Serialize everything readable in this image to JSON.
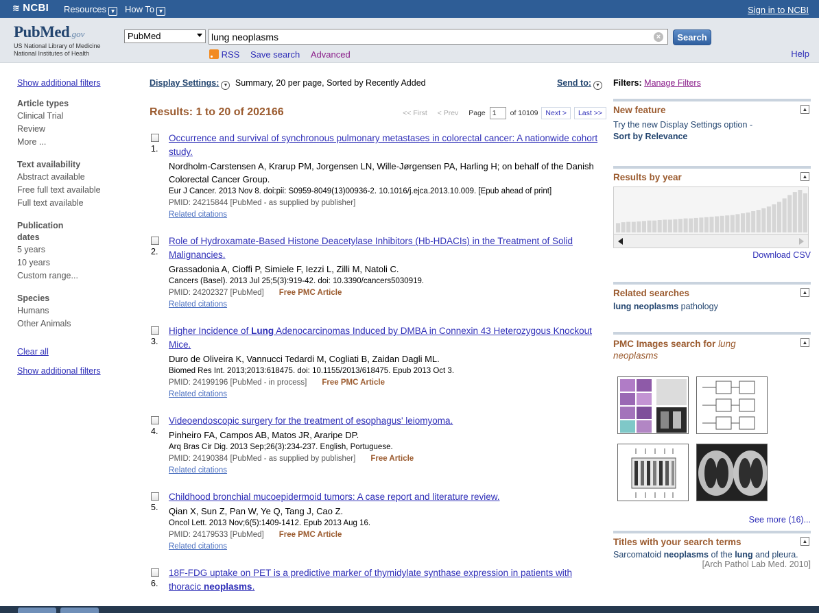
{
  "topbar": {
    "brand": "NCBI",
    "menus": [
      "Resources",
      "How To"
    ],
    "signin": "Sign in to NCBI"
  },
  "header": {
    "logo_pub": "Pub",
    "logo_med": "Med",
    "logo_gov": ".gov",
    "logo_line1": "US National Library of Medicine",
    "logo_line2": "National Institutes of Health",
    "database": "PubMed",
    "query": "lung neoplasms",
    "search_button": "Search",
    "rss": "RSS",
    "save_search": "Save search",
    "advanced": "Advanced",
    "help": "Help"
  },
  "left": {
    "show_filters_top": "Show additional filters",
    "groups": [
      {
        "title": "Article types",
        "items": [
          "Clinical Trial",
          "Review",
          "More ..."
        ]
      },
      {
        "title": "Text availability",
        "items": [
          "Abstract available",
          "Free full text available",
          "Full text available"
        ]
      },
      {
        "title": "Publication dates",
        "items": [
          "5 years",
          "10 years",
          "Custom range..."
        ]
      },
      {
        "title": "Species",
        "items": [
          "Humans",
          "Other Animals"
        ]
      }
    ],
    "clear_all": "Clear all",
    "show_filters_bottom": "Show additional filters"
  },
  "main": {
    "display_settings": "Display Settings:",
    "display_summary": "Summary, 20 per page, Sorted by Recently Added",
    "send_to": "Send to:",
    "results_label": "Results: 1 to 20 of 202166",
    "pager": {
      "first": "<< First",
      "prev": "< Prev",
      "page_label": "Page",
      "page_value": "1",
      "of_label": "of 10109",
      "next": "Next >",
      "last": "Last >>"
    },
    "results": [
      {
        "num": "1.",
        "title_parts": [
          "Occurrence and survival of synchronous pulmonary metastases in colorectal cancer: A nationwide cohort study."
        ],
        "authors": "Nordholm-Carstensen A, Krarup PM, Jorgensen LN, Wille-Jørgensen PA, Harling H; on behalf of the Danish Colorectal Cancer Group.",
        "journal": "Eur J Cancer. 2013 Nov 8. doi:pii: S0959-8049(13)00936-2. 10.1016/j.ejca.2013.10.009. [Epub ahead of print]",
        "pmid": "PMID: 24215844 [PubMed - as supplied by publisher]",
        "free": "",
        "related": "Related citations"
      },
      {
        "num": "2.",
        "title_parts": [
          "Role of Hydroxamate-Based Histone Deacetylase Inhibitors (Hb-HDACIs) in the Treatment of Solid Malignancies."
        ],
        "authors": "Grassadonia A, Cioffi P, Simiele F, Iezzi L, Zilli M, Natoli C.",
        "journal": "Cancers (Basel). 2013 Jul 25;5(3):919-42. doi: 10.3390/cancers5030919.",
        "pmid": "PMID: 24202327 [PubMed]",
        "free": "Free PMC Article",
        "related": "Related citations"
      },
      {
        "num": "3.",
        "title_parts": [
          "Higher Incidence of ",
          "Lung",
          " Adenocarcinomas Induced by DMBA in Connexin 43 Heterozygous Knockout Mice."
        ],
        "authors": "Duro de Oliveira K, Vannucci Tedardi M, Cogliati B, Zaidan Dagli ML.",
        "journal": "Biomed Res Int. 2013;2013:618475. doi: 10.1155/2013/618475. Epub 2013 Oct 3.",
        "pmid": "PMID: 24199196 [PubMed - in process]",
        "free": "Free PMC Article",
        "related": "Related citations"
      },
      {
        "num": "4.",
        "title_parts": [
          "Videoendoscopic surgery for the treatment of esophagus' leiomyoma."
        ],
        "authors": "Pinheiro FA, Campos AB, Matos JR, Araripe DP.",
        "journal": "Arq Bras Cir Dig. 2013 Sep;26(3):234-237. English, Portuguese.",
        "pmid": "PMID: 24190384 [PubMed - as supplied by publisher]",
        "free": "Free Article",
        "related": "Related citations"
      },
      {
        "num": "5.",
        "title_parts": [
          "Childhood bronchial mucoepidermoid tumors: A case report and literature review."
        ],
        "authors": "Qian X, Sun Z, Pan W, Ye Q, Tang J, Cao Z.",
        "journal": "Oncol Lett. 2013 Nov;6(5):1409-1412. Epub 2013 Aug 16.",
        "pmid": "PMID: 24179533 [PubMed]",
        "free": "Free PMC Article",
        "related": "Related citations"
      },
      {
        "num": "6.",
        "title_parts": [
          "18F-FDG uptake on PET is a predictive marker of thymidylate synthase expression in patients with thoracic ",
          "neoplasms",
          "."
        ],
        "authors": "",
        "journal": "",
        "pmid": "",
        "free": "",
        "related": ""
      }
    ]
  },
  "right": {
    "filters_label": "Filters:",
    "manage_filters": "Manage Filters",
    "new_feature_title": "New feature",
    "new_feature_text": "Try the new Display Settings option -",
    "new_feature_link": "Sort by Relevance",
    "results_by_year_title": "Results by year",
    "download_csv": "Download CSV",
    "related_searches_title": "Related searches",
    "related_bold": "lung neoplasms",
    "related_rest": " pathology",
    "pmc_title": "PMC Images search for ",
    "pmc_term": "lung neoplasms",
    "see_more": "See more (16)...",
    "titles_title": "Titles with your search terms",
    "titles_item_parts": [
      "Sarcomatoid ",
      "neoplasms",
      " of the ",
      "lung",
      " and pleura."
    ],
    "titles_item_source": "[Arch Pathol Lab Med. 2010]"
  },
  "year_bars": [
    0.22,
    0.24,
    0.25,
    0.25,
    0.26,
    0.27,
    0.28,
    0.28,
    0.29,
    0.3,
    0.3,
    0.31,
    0.32,
    0.33,
    0.33,
    0.34,
    0.35,
    0.36,
    0.37,
    0.38,
    0.39,
    0.4,
    0.41,
    0.43,
    0.45,
    0.47,
    0.5,
    0.53,
    0.57,
    0.61,
    0.66,
    0.72,
    0.8,
    0.88,
    0.95,
    1.0,
    0.92
  ],
  "colors": {
    "link": "#2f2fb8",
    "accent_orange": "#9b5b2f",
    "header_bg": "#2e5d96"
  }
}
